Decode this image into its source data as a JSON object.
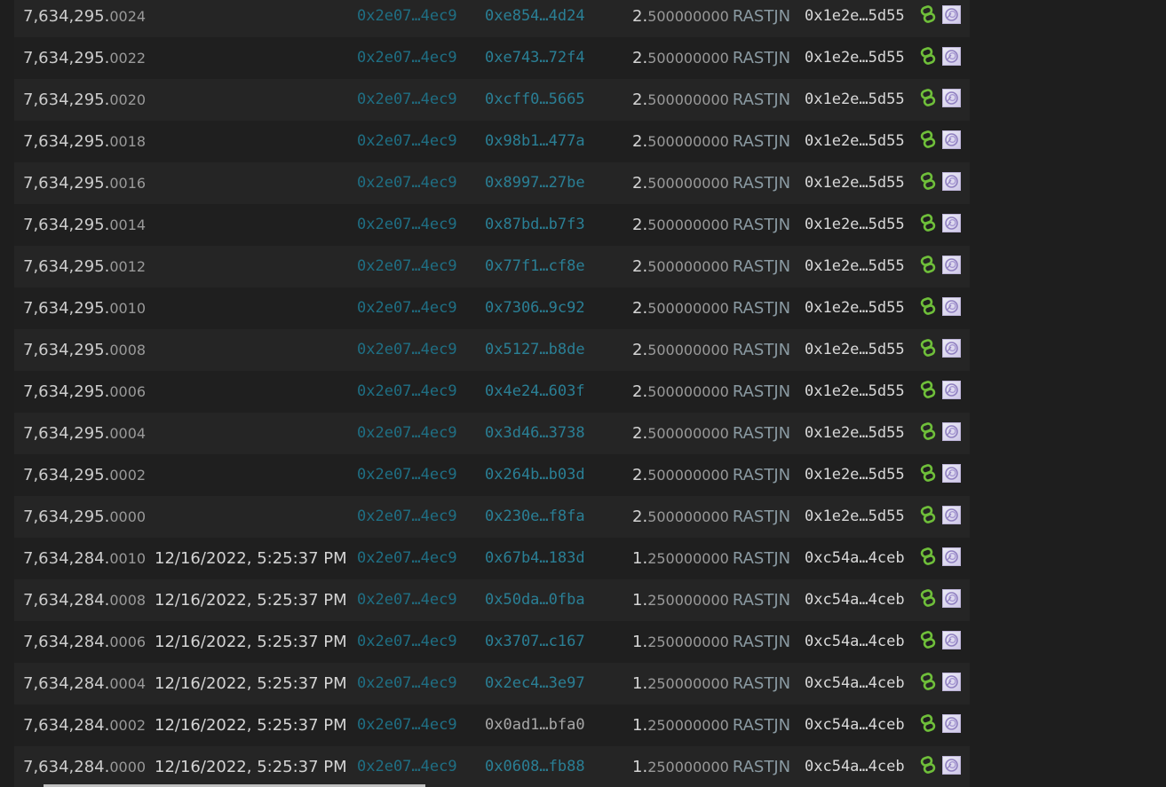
{
  "unit": "RASTJN",
  "rows": [
    {
      "block_int": "7,634,295.",
      "block_frac": "0024",
      "time": "",
      "from": "0x2e07…4ec9",
      "to": "0xe854…4d24",
      "amt_int": "2.",
      "amt_frac": "500000000",
      "owner": "0x1e2e…5d55"
    },
    {
      "block_int": "7,634,295.",
      "block_frac": "0022",
      "time": "",
      "from": "0x2e07…4ec9",
      "to": "0xe743…72f4",
      "amt_int": "2.",
      "amt_frac": "500000000",
      "owner": "0x1e2e…5d55"
    },
    {
      "block_int": "7,634,295.",
      "block_frac": "0020",
      "time": "",
      "from": "0x2e07…4ec9",
      "to": "0xcff0…5665",
      "amt_int": "2.",
      "amt_frac": "500000000",
      "owner": "0x1e2e…5d55"
    },
    {
      "block_int": "7,634,295.",
      "block_frac": "0018",
      "time": "",
      "from": "0x2e07…4ec9",
      "to": "0x98b1…477a",
      "amt_int": "2.",
      "amt_frac": "500000000",
      "owner": "0x1e2e…5d55"
    },
    {
      "block_int": "7,634,295.",
      "block_frac": "0016",
      "time": "",
      "from": "0x2e07…4ec9",
      "to": "0x8997…27be",
      "amt_int": "2.",
      "amt_frac": "500000000",
      "owner": "0x1e2e…5d55"
    },
    {
      "block_int": "7,634,295.",
      "block_frac": "0014",
      "time": "",
      "from": "0x2e07…4ec9",
      "to": "0x87bd…b7f3",
      "amt_int": "2.",
      "amt_frac": "500000000",
      "owner": "0x1e2e…5d55"
    },
    {
      "block_int": "7,634,295.",
      "block_frac": "0012",
      "time": "",
      "from": "0x2e07…4ec9",
      "to": "0x77f1…cf8e",
      "amt_int": "2.",
      "amt_frac": "500000000",
      "owner": "0x1e2e…5d55"
    },
    {
      "block_int": "7,634,295.",
      "block_frac": "0010",
      "time": "",
      "from": "0x2e07…4ec9",
      "to": "0x7306…9c92",
      "amt_int": "2.",
      "amt_frac": "500000000",
      "owner": "0x1e2e…5d55"
    },
    {
      "block_int": "7,634,295.",
      "block_frac": "0008",
      "time": "",
      "from": "0x2e07…4ec9",
      "to": "0x5127…b8de",
      "amt_int": "2.",
      "amt_frac": "500000000",
      "owner": "0x1e2e…5d55"
    },
    {
      "block_int": "7,634,295.",
      "block_frac": "0006",
      "time": "",
      "from": "0x2e07…4ec9",
      "to": "0x4e24…603f",
      "amt_int": "2.",
      "amt_frac": "500000000",
      "owner": "0x1e2e…5d55"
    },
    {
      "block_int": "7,634,295.",
      "block_frac": "0004",
      "time": "",
      "from": "0x2e07…4ec9",
      "to": "0x3d46…3738",
      "amt_int": "2.",
      "amt_frac": "500000000",
      "owner": "0x1e2e…5d55"
    },
    {
      "block_int": "7,634,295.",
      "block_frac": "0002",
      "time": "",
      "from": "0x2e07…4ec9",
      "to": "0x264b…b03d",
      "amt_int": "2.",
      "amt_frac": "500000000",
      "owner": "0x1e2e…5d55"
    },
    {
      "block_int": "7,634,295.",
      "block_frac": "0000",
      "time": "",
      "from": "0x2e07…4ec9",
      "to": "0x230e…f8fa",
      "amt_int": "2.",
      "amt_frac": "500000000",
      "owner": "0x1e2e…5d55"
    },
    {
      "block_int": "7,634,284.",
      "block_frac": "0010",
      "time": "12/16/2022, 5:25:37 PM",
      "from": "0x2e07…4ec9",
      "to": "0x67b4…183d",
      "amt_int": "1.",
      "amt_frac": "250000000",
      "owner": "0xc54a…4ceb"
    },
    {
      "block_int": "7,634,284.",
      "block_frac": "0008",
      "time": "12/16/2022, 5:25:37 PM",
      "from": "0x2e07…4ec9",
      "to": "0x50da…0fba",
      "amt_int": "1.",
      "amt_frac": "250000000",
      "owner": "0xc54a…4ceb"
    },
    {
      "block_int": "7,634,284.",
      "block_frac": "0006",
      "time": "12/16/2022, 5:25:37 PM",
      "from": "0x2e07…4ec9",
      "to": "0x3707…c167",
      "amt_int": "1.",
      "amt_frac": "250000000",
      "owner": "0xc54a…4ceb"
    },
    {
      "block_int": "7,634,284.",
      "block_frac": "0004",
      "time": "12/16/2022, 5:25:37 PM",
      "from": "0x2e07…4ec9",
      "to": "0x2ec4…3e97",
      "amt_int": "1.",
      "amt_frac": "250000000",
      "owner": "0xc54a…4ceb"
    },
    {
      "block_int": "7,634,284.",
      "block_frac": "0002",
      "time": "12/16/2022, 5:25:37 PM",
      "from": "0x2e07…4ec9",
      "to": "0x0ad1…bfa0",
      "amt_int": "1.",
      "amt_frac": "250000000",
      "owner": "0xc54a…4ceb",
      "to_dim": true
    },
    {
      "block_int": "7,634,284.",
      "block_frac": "0000",
      "time": "12/16/2022, 5:25:37 PM",
      "from": "0x2e07…4ec9",
      "to": "0x0608…fb88",
      "amt_int": "1.",
      "amt_frac": "250000000",
      "owner": "0xc54a…4ceb"
    }
  ],
  "icons": {
    "link": "chain-link-icon",
    "nft": "nft-thumbnail-icon"
  },
  "colors": {
    "address_link": "#2a7f95",
    "link_icon": "#6fbf3a",
    "background": "#1e1e1e"
  }
}
